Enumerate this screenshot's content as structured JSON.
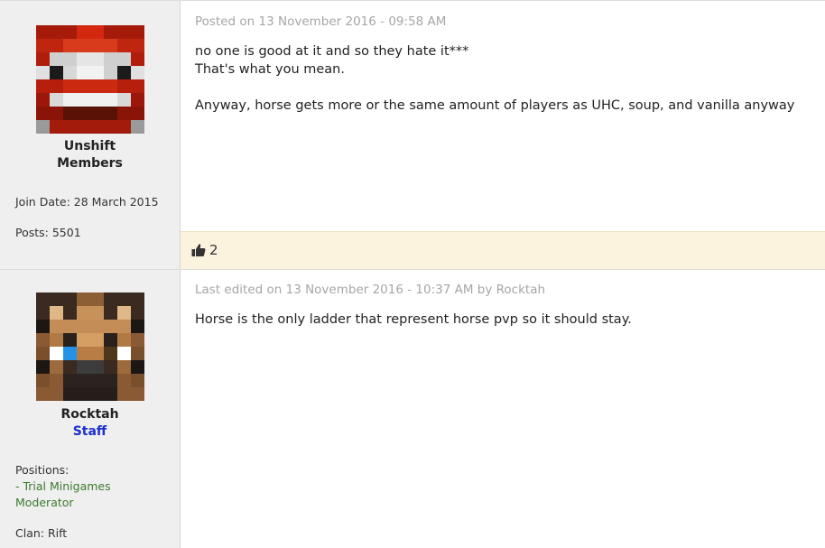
{
  "posts": [
    {
      "author": {
        "name": "Unshift",
        "role": "Members",
        "join_date": "Join Date: 28 March 2015",
        "posts": "Posts: 5501"
      },
      "timestamp": "Posted on 13 November 2016 - 09:58 AM",
      "body": [
        "no one is good at it and so they hate it***",
        "That's what you mean.",
        "",
        "Anyway, horse gets more or the same amount of players as UHC, soup, and vanilla anyway"
      ],
      "likes": "2"
    },
    {
      "author": {
        "name": "Rocktah",
        "role": "Staff",
        "positions_label": "Positions:",
        "positions": [
          "- Trial Minigames",
          "Moderator"
        ],
        "clan": "Clan: Rift"
      },
      "timestamp": "Last edited on 13 November 2016 - 10:37 AM by Rocktah",
      "body": [
        "Horse is the only ladder that represent horse pvp so it should stay."
      ]
    }
  ],
  "icons": {
    "like": "thumbs-up-icon"
  },
  "colors": {
    "staff_role": "#1a2fd1",
    "positions_text": "#3b7a2d",
    "likes_bar": "#fcf3df",
    "sidebar": "#efefef",
    "timestamp": "#a6a6a6"
  }
}
